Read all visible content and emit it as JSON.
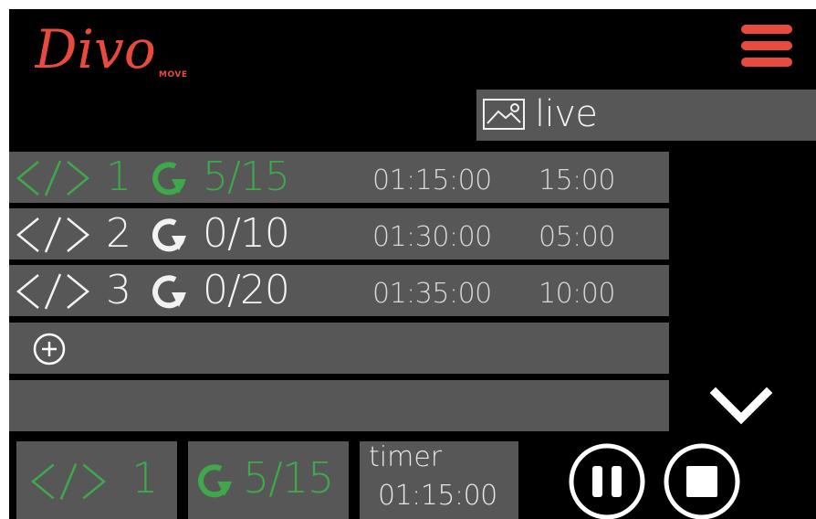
{
  "app": {
    "logo_text": "Divo",
    "logo_sub": "MOVE"
  },
  "header": {
    "menu_icon": "hamburger-icon",
    "live_label": "live",
    "live_icon": "image-icon"
  },
  "rows": [
    {
      "index": "1",
      "count": "5/15",
      "time": "01:15:00",
      "duration": "15:00",
      "active": true
    },
    {
      "index": "2",
      "count": "0/10",
      "time": "01:30:00",
      "duration": "05:00",
      "active": false
    },
    {
      "index": "3",
      "count": "0/20",
      "time": "01:35:00",
      "duration": "10:00",
      "active": false
    }
  ],
  "add_row_icon": "add-circle-icon",
  "expand_icon": "chevron-down-icon",
  "status": {
    "current_index": "1",
    "current_count": "5/15",
    "timer_label": "timer",
    "timer_value": "01:15:00"
  },
  "controls": {
    "pause_icon": "pause-icon",
    "stop_icon": "stop-icon"
  },
  "colors": {
    "accent": "#e84a3d",
    "active": "#3fa84a",
    "row_bg": "#575757",
    "background": "#000000"
  }
}
